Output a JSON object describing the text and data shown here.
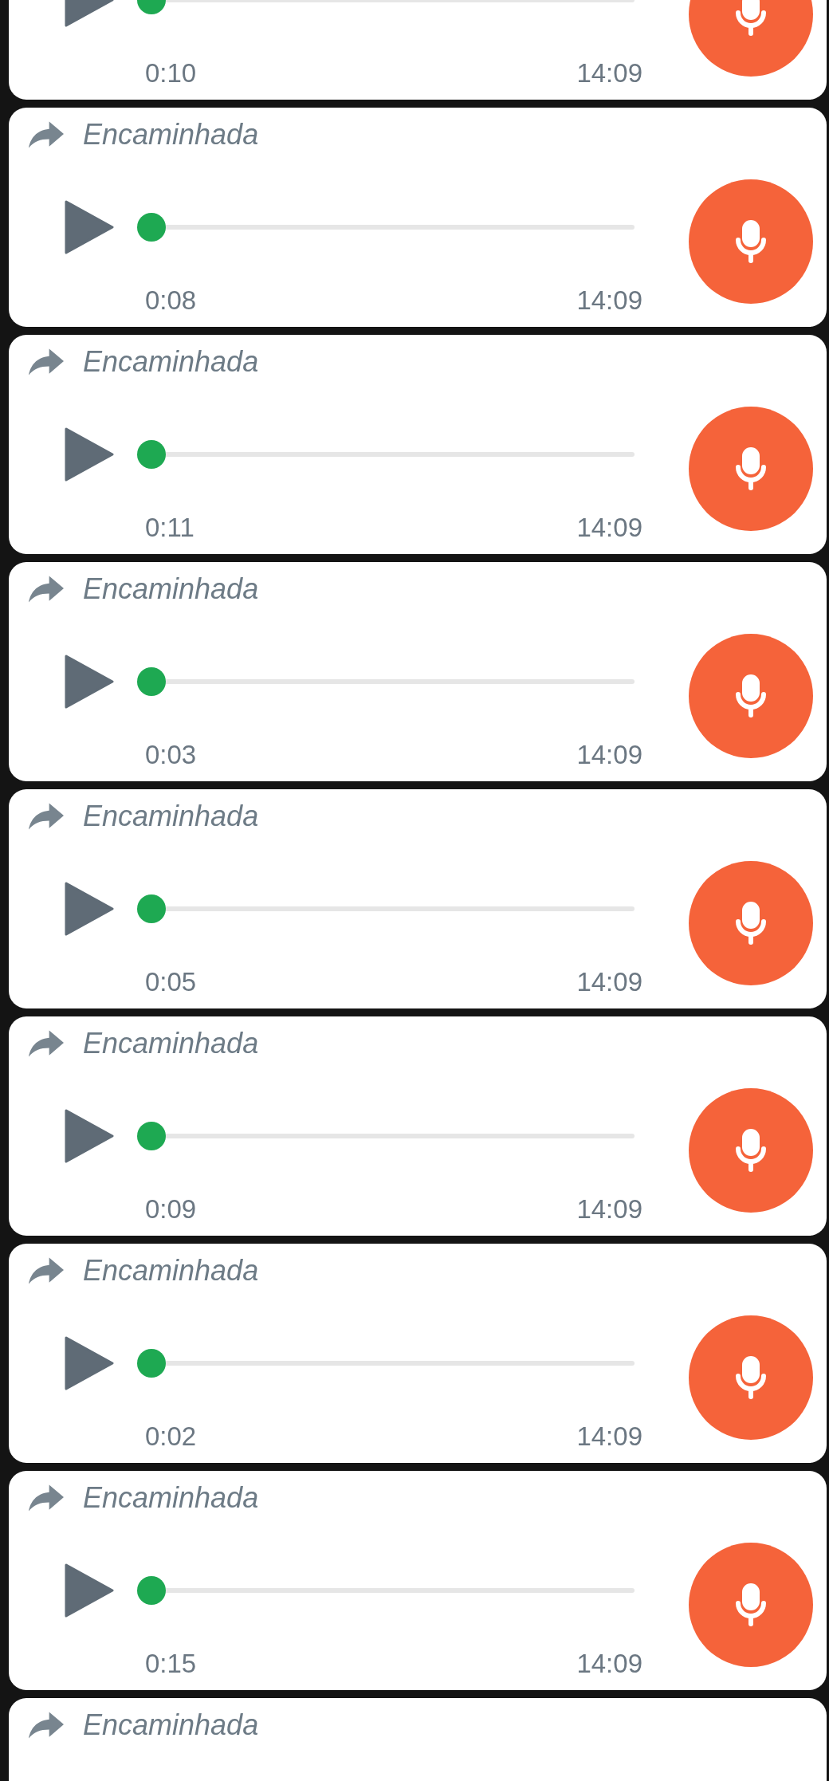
{
  "messages": [
    {
      "duration": "0:10",
      "time": "14:09",
      "level": 0
    },
    {
      "label": "Encaminhada",
      "duration": "0:08",
      "time": "14:09",
      "level": 0
    },
    {
      "label": "Encaminhada",
      "duration": "0:11",
      "time": "14:09",
      "level": 0
    },
    {
      "label": "Encaminhada",
      "duration": "0:03",
      "time": "14:09",
      "level": 0
    },
    {
      "label": "Encaminhada",
      "duration": "0:05",
      "time": "14:09",
      "level": 0
    },
    {
      "label": "Encaminhada",
      "duration": "0:09",
      "time": "14:09",
      "level": 0
    },
    {
      "label": "Encaminhada",
      "duration": "0:02",
      "time": "14:09",
      "level": 0
    },
    {
      "label": "Encaminhada",
      "duration": "0:15",
      "time": "14:09",
      "level": 0
    },
    {
      "label": "Encaminhada"
    }
  ]
}
